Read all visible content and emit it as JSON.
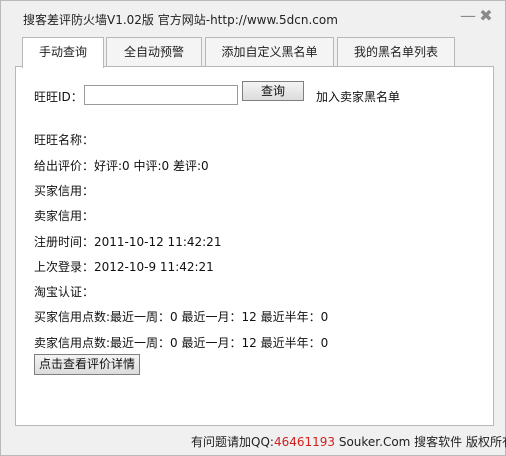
{
  "window": {
    "title": "搜客差评防火墙V1.02版 官方网站-http://www.5dcn.com",
    "minimize_glyph": "—",
    "close_glyph": "✖"
  },
  "tabs": [
    {
      "label": "手动查询",
      "active": true
    },
    {
      "label": "全自动预警",
      "active": false
    },
    {
      "label": "添加自定义黑名单",
      "active": false
    },
    {
      "label": "我的黑名单列表",
      "active": false
    }
  ],
  "query": {
    "id_label": "旺旺ID：",
    "input_value": "",
    "query_button": "查询",
    "add_blacklist": "加入卖家黑名单"
  },
  "info": {
    "wangwang_name": "旺旺名称：",
    "given_rating": "给出评价：好评:0 中评:0 差评:0",
    "buyer_credit": "买家信用：",
    "seller_credit": "卖家信用：",
    "register_time": "注册时间：2011-10-12 11:42:21",
    "last_login": "上次登录：2012-10-9 11:42:21",
    "taobao_auth": "淘宝认证：",
    "buyer_points": "买家信用点数:最近一周：0 最近一月：12 最近半年：0",
    "seller_points": "卖家信用点数:最近一周：0 最近一月：12 最近半年：0"
  },
  "detail_button": "点击查看评价详情",
  "footer": {
    "prefix": "有问题请加QQ:",
    "qq": "46461193",
    "suffix": " Souker.Com 搜客软件 版权所有"
  }
}
